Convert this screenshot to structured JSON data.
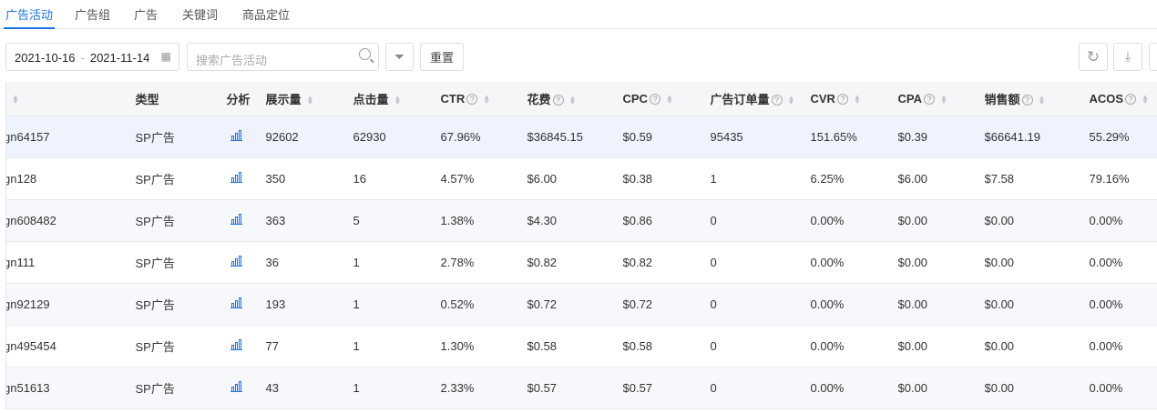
{
  "tabs": [
    "广告活动",
    "广告组",
    "广告",
    "关键词",
    "商品定位"
  ],
  "toolbar": {
    "date_start": "2021-10-16",
    "date_sep": "-",
    "date_end": "2021-11-14",
    "search_placeholder": "搜索广告活动",
    "reset_label": "重置"
  },
  "columns": [
    "",
    "类型",
    "分析",
    "展示量",
    "点击量",
    "CTR",
    "花费",
    "CPC",
    "广告订单量",
    "CVR",
    "CPA",
    "销售额",
    "ACOS"
  ],
  "rows": [
    [
      "gn64157",
      "SP广告",
      "92602",
      "62930",
      "67.96%",
      "$36845.15",
      "$0.59",
      "95435",
      "151.65%",
      "$0.39",
      "$66641.19",
      "55.29%"
    ],
    [
      "gn128",
      "SP广告",
      "350",
      "16",
      "4.57%",
      "$6.00",
      "$0.38",
      "1",
      "6.25%",
      "$6.00",
      "$7.58",
      "79.16%"
    ],
    [
      "gn608482",
      "SP广告",
      "363",
      "5",
      "1.38%",
      "$4.30",
      "$0.86",
      "0",
      "0.00%",
      "$0.00",
      "$0.00",
      "0.00%"
    ],
    [
      "gn111",
      "SP广告",
      "36",
      "1",
      "2.78%",
      "$0.82",
      "$0.82",
      "0",
      "0.00%",
      "$0.00",
      "$0.00",
      "0.00%"
    ],
    [
      "gn92129",
      "SP广告",
      "193",
      "1",
      "0.52%",
      "$0.72",
      "$0.72",
      "0",
      "0.00%",
      "$0.00",
      "$0.00",
      "0.00%"
    ],
    [
      "gn495454",
      "SP广告",
      "77",
      "1",
      "1.30%",
      "$0.58",
      "$0.58",
      "0",
      "0.00%",
      "$0.00",
      "$0.00",
      "0.00%"
    ],
    [
      "gn51613",
      "SP广告",
      "43",
      "1",
      "2.33%",
      "$0.57",
      "$0.57",
      "0",
      "0.00%",
      "$0.00",
      "$0.00",
      "0.00%"
    ]
  ]
}
